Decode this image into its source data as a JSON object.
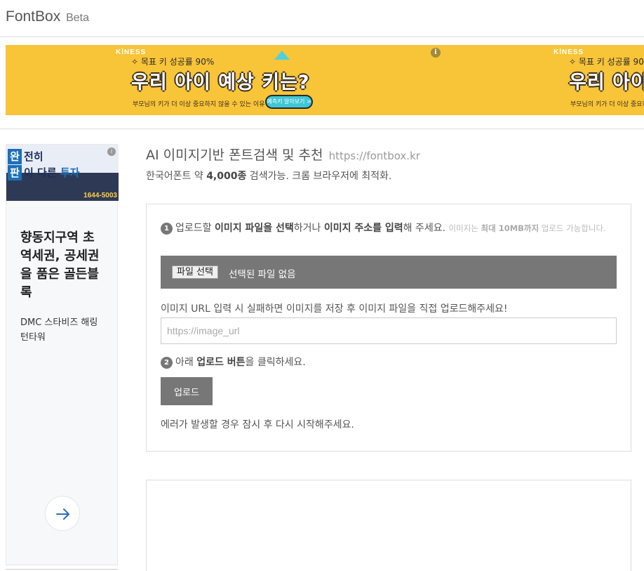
{
  "header": {
    "logo": "FontBox",
    "badge": "Beta"
  },
  "top_ad": {
    "brand": "KİNESS",
    "tagline": "✧ 목표 키 성공률 90%",
    "headline": "우리 아이 예상 키는?",
    "subtext": "부모님의 키가 더 이상 중요하지 않을 수 있는 이유",
    "cta": "예측키 알아보기 >",
    "info_icon": "i",
    "accent_color": "#f8c438"
  },
  "side_ad": {
    "banner": {
      "line1_box": "완",
      "line1_text": "전히",
      "line2_box": "판",
      "line2_text": "이 다른 ",
      "line2_accent": "투자",
      "phone": "1644-5003",
      "info": "i"
    },
    "title": "향동지구역 초역세권, 공세권을 품은 골든블록",
    "description": "DMC 스타비즈 해링턴타워",
    "arrow_icon": "arrow-right-icon"
  },
  "main": {
    "title": "AI 이미지기반 폰트검색 및 추천",
    "title_url": "https://fontbox.kr",
    "subtitle_pre": "한국어폰트 약 ",
    "subtitle_count": "4,000종",
    "subtitle_post": " 검색가능. 크롬 브라우저에 최적화.",
    "step1": {
      "number": "1",
      "t1": "업로드할 ",
      "b1": "이미지 파일을 선택",
      "t2": "하거나 ",
      "b2": "이미지 주소를 입력",
      "t3": "해 주세요. ",
      "note_pre": "이미지는 ",
      "note_bold": "최대 10MB까지",
      "note_post": " 업로드 가능합니다."
    },
    "file_button": "파일 선택",
    "file_status": "선택된 파일 없음",
    "url_hint": "이미지 URL 입력 시 실패하면 이미지를 저장 후 이미지 파일을 직접 업로드해주세요!",
    "url_placeholder": "https://image_url",
    "url_value": "",
    "step2": {
      "number": "2",
      "t1": "아래 ",
      "b1": "업로드 버튼",
      "t2": "을 클릭하세요."
    },
    "upload_button": "업로드",
    "error_note": "에러가 발생할 경우 잠시 후 다시 시작해주세요."
  }
}
